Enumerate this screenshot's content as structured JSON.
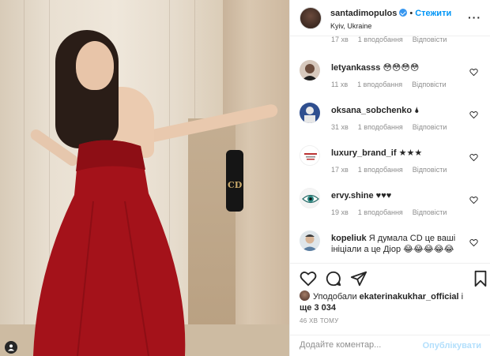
{
  "post": {
    "username": "santadimopulos",
    "follow_label": "Стежити",
    "location": "Kyiv, Ukraine",
    "more_icon": "ellipsis-icon"
  },
  "partial_comment": {
    "time": "17 хв",
    "likes": "1 вподобання",
    "reply": "Відповісти"
  },
  "comments": [
    {
      "username": "letyankasss",
      "text": "😳😳😳😳",
      "time": "11 хв",
      "likes": "1 вподобання",
      "reply": "Відповісти"
    },
    {
      "username": "oksana_sobchenko",
      "text": "🌢",
      "time": "31 хв",
      "likes": "1 вподобання",
      "reply": "Відповісти"
    },
    {
      "username": "luxury_brand_if",
      "text": "★★★",
      "time": "17 хв",
      "likes": "1 вподобання",
      "reply": "Відповісти"
    },
    {
      "username": "ervy.shine",
      "text": "♥♥♥",
      "time": "19 хв",
      "likes": "1 вподобання",
      "reply": "Відповісти"
    },
    {
      "username": "kopeliuk",
      "text": "Я думала CD це ваші ініціали а це Діор 😂😂😂😂😂",
      "time": "",
      "likes": "",
      "reply": ""
    }
  ],
  "likes_line": {
    "prefix": "Уподобали",
    "user": "ekaterinakukhar_official",
    "middle": "і",
    "suffix": "ще 3 034"
  },
  "timestamp": "46 ХВ ТОМУ",
  "add_comment": {
    "placeholder": "Додайте коментар...",
    "post_label": "Опублікувати"
  },
  "colors": {
    "accent": "#0095f6",
    "post_disabled": "#b2dffc",
    "muted": "#8e8e8e",
    "text": "#262626"
  }
}
